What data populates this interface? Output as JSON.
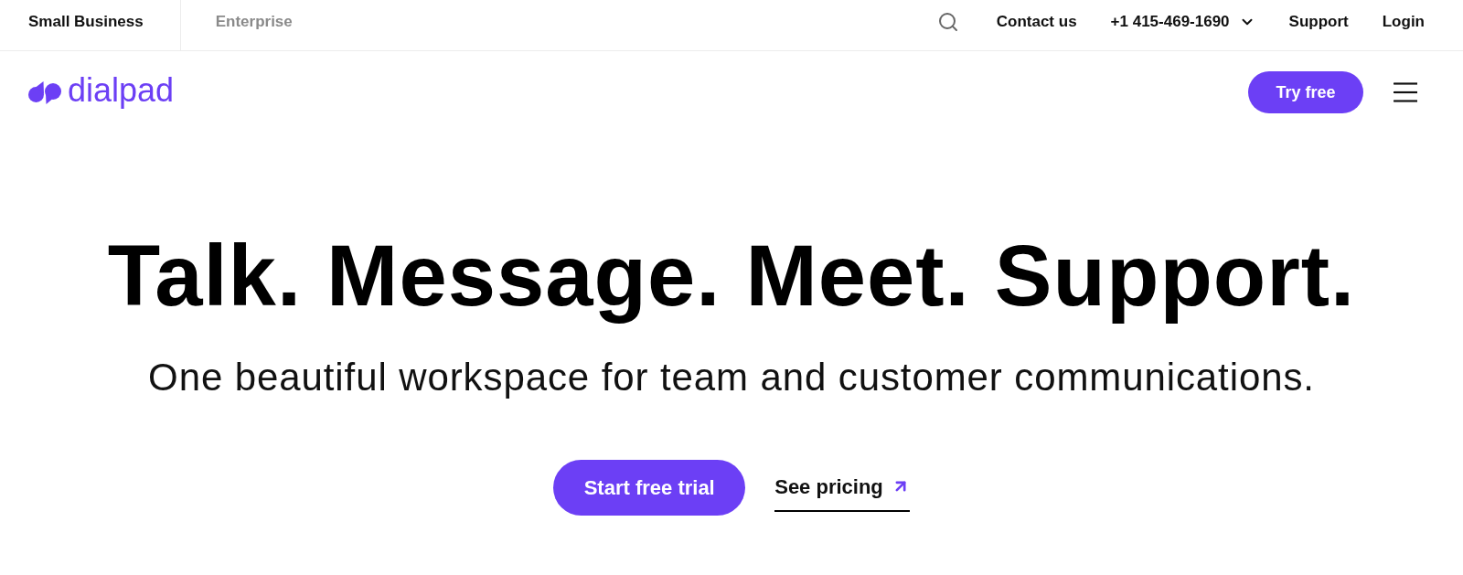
{
  "top_bar": {
    "segments": [
      {
        "label": "Small Business",
        "selected": true
      },
      {
        "label": "Enterprise",
        "selected": false
      }
    ],
    "utility_links": [
      {
        "kind": "link",
        "label": "Contact us"
      },
      {
        "kind": "dropdown",
        "label": "+1 415-469-1690"
      },
      {
        "kind": "link",
        "label": "Support"
      },
      {
        "kind": "link",
        "label": "Login"
      }
    ]
  },
  "header": {
    "logo_text": "dialpad",
    "cta": "Try free"
  },
  "hero": {
    "headline": "Talk. Message. Meet. Support.",
    "subheadline": "One beautiful workspace for team and customer communications.",
    "primary_button": "Start free trial",
    "secondary_link": "See pricing"
  }
}
